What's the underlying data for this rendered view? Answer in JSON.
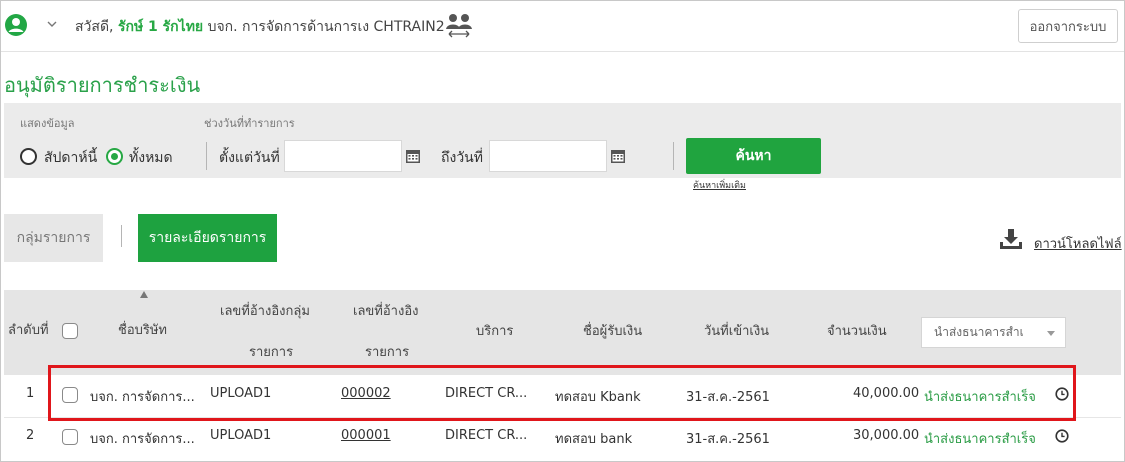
{
  "header": {
    "greeting": "สวัสดี,",
    "user_name": "รักษ์ 1 รักไทย",
    "org_text": "บจก. การจัดการด้านการเง CHTRAIN2",
    "logout_label": "ออกจากระบบ"
  },
  "page_title": "อนุมัติรายการชำระเงิน",
  "filter": {
    "display_label": "แสดงข้อมูล",
    "date_range_label": "ช่วงวันที่ทำรายการ",
    "radio_week": "สัปดาห์นี้",
    "radio_all": "ทั้งหมด",
    "from_label": "ตั้งแต่วันที่",
    "to_label": "ถึงวันที่",
    "from_value": "",
    "to_value": "",
    "search_label": "ค้นหา",
    "advanced_search": "ค้นหาเพิ่มเติม"
  },
  "tabs": {
    "group": "กลุ่มรายการ",
    "detail": "รายละเอียดรายการ"
  },
  "download_label": "ดาวน์โหลดไฟล์",
  "table": {
    "headers": {
      "seq": "ลำดับที่",
      "company": "ชื่อบริษัท",
      "group_ref_1": "เลขที่อ้างอิงกลุ่ม",
      "group_ref_2": "รายการ",
      "ref_1": "เลขที่อ้างอิง",
      "ref_2": "รายการ",
      "service": "บริการ",
      "payee": "ชื่อผู้รับเงิน",
      "date": "วันที่เข้าเงิน",
      "amount": "จำนวนเงิน",
      "status_filter": "นำส่งธนาคารสำเ"
    },
    "rows": [
      {
        "seq": "1",
        "company": "บจก. การจัดการ...",
        "group_ref": "UPLOAD1",
        "ref": "000002",
        "service": "DIRECT CR...",
        "payee": "ทดสอบ Kbank",
        "date": "31-ส.ค.-2561",
        "amount": "40,000.00",
        "status": "นำส่งธนาคารสำเร็จ"
      },
      {
        "seq": "2",
        "company": "บจก. การจัดการ...",
        "group_ref": "UPLOAD1",
        "ref": "000001",
        "service": "DIRECT CR...",
        "payee": "ทดสอบ bank",
        "date": "31-ส.ค.-2561",
        "amount": "30,000.00",
        "status": "นำส่งธนาคารสำเร็จ"
      }
    ]
  },
  "colors": {
    "accent_green": "#20a43f",
    "highlight_red": "#e0161b"
  },
  "icons": [
    "user-circle-icon",
    "chevron-down-icon",
    "switch-user-icon",
    "calendar-icon",
    "download-icon",
    "sort-up-icon",
    "clock-icon"
  ]
}
